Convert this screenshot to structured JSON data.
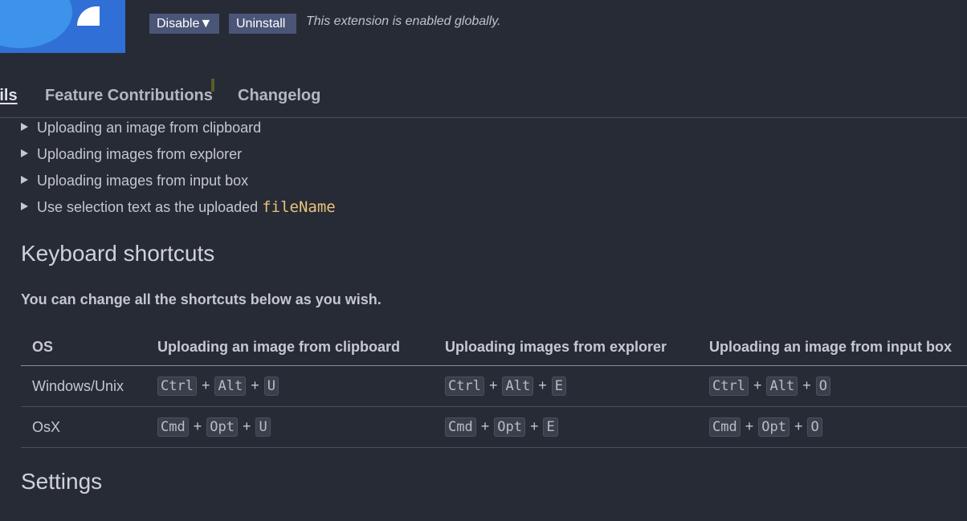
{
  "header": {
    "disable_label": "Disable▼",
    "uninstall_label": "Uninstall",
    "status_text": "This extension is enabled globally."
  },
  "tabs": [
    {
      "label": "Details",
      "active": true
    },
    {
      "label": "Feature Contributions"
    },
    {
      "label": "Changelog"
    }
  ],
  "details": [
    {
      "text": "Uploading an image from clipboard"
    },
    {
      "text": "Uploading images from explorer"
    },
    {
      "text": "Uploading images from input box"
    },
    {
      "text": "Use selection text as the uploaded ",
      "code": "fileName"
    }
  ],
  "keyboard": {
    "heading": "Keyboard shortcuts",
    "note": "You can change all the shortcuts below as you wish.",
    "columns": [
      "OS",
      "Uploading an image from clipboard",
      "Uploading images from explorer",
      "Uploading an image from input box"
    ],
    "rows": [
      {
        "os": "Windows/Unix",
        "shortcuts": [
          [
            "Ctrl",
            "Alt",
            "U"
          ],
          [
            "Ctrl",
            "Alt",
            "E"
          ],
          [
            "Ctrl",
            "Alt",
            "O"
          ]
        ]
      },
      {
        "os": "OsX",
        "shortcuts": [
          [
            "Cmd",
            "Opt",
            "U"
          ],
          [
            "Cmd",
            "Opt",
            "E"
          ],
          [
            "Cmd",
            "Opt",
            "O"
          ]
        ]
      }
    ],
    "separator": "+"
  },
  "settings": {
    "heading": "Settings"
  },
  "colors": {
    "background": "#272b36",
    "button": "#4a5577",
    "code": "#e8c27a"
  }
}
